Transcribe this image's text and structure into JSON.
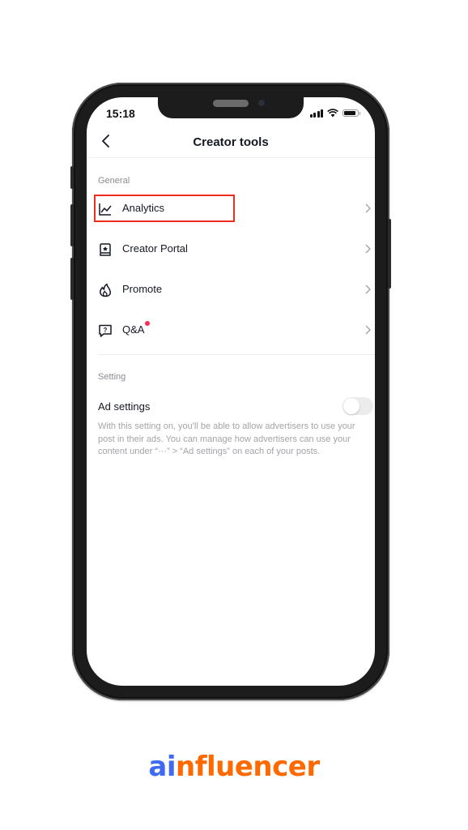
{
  "status_bar": {
    "time": "15:18",
    "battery_level": 0.85
  },
  "header": {
    "title": "Creator tools",
    "back_icon": "chevron-left-icon"
  },
  "sections": {
    "general": {
      "label": "General",
      "items": [
        {
          "label": "Analytics",
          "icon": "line-chart-icon",
          "highlighted": true,
          "badge": false
        },
        {
          "label": "Creator Portal",
          "icon": "portal-book-icon",
          "highlighted": false,
          "badge": false
        },
        {
          "label": "Promote",
          "icon": "flame-icon",
          "highlighted": false,
          "badge": false
        },
        {
          "label": "Q&A",
          "icon": "question-bubble-icon",
          "highlighted": false,
          "badge": true
        }
      ]
    },
    "setting": {
      "label": "Setting",
      "ad_settings": {
        "label": "Ad settings",
        "enabled": false,
        "description": "With this setting on, you'll be able to allow advertisers to use your post in their ads. You can manage how advertisers can use your content under “···” > “Ad settings” on each of your posts."
      }
    }
  },
  "colors": {
    "highlight": "#f02c1f",
    "badge": "#fe2c55",
    "logo_ai": "#3f6af4",
    "logo_rest": "#ff6a00"
  },
  "branding": {
    "logo_part1": "ai",
    "logo_part2": "nfluencer"
  }
}
